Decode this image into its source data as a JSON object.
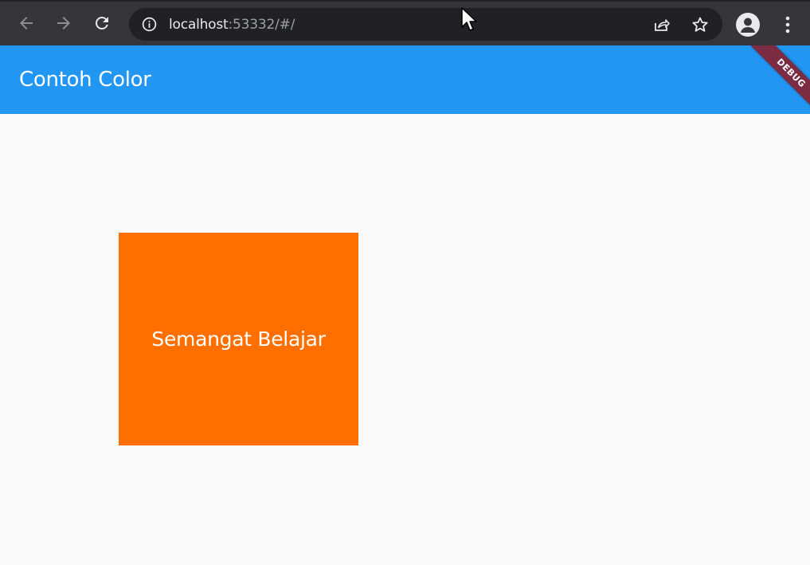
{
  "browser": {
    "url_host": "localhost",
    "url_rest": ":53332/#/",
    "icons": [
      "back-arrow-icon",
      "forward-arrow-icon",
      "reload-icon",
      "info-icon",
      "share-icon",
      "star-icon",
      "profile-icon",
      "menu-dots-icon"
    ]
  },
  "app": {
    "title": "Contoh Color",
    "debug_label": "DEBUG",
    "colors": {
      "app_bar": "#2196f3",
      "box": "#ff6f00",
      "background": "#fafafa"
    }
  },
  "main": {
    "box_text": "Semangat Belajar"
  }
}
